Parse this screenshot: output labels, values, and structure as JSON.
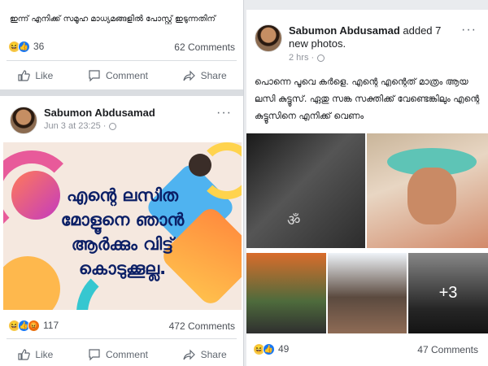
{
  "left_post_top": {
    "text": "ഇന്ന് എനിക്ക് സമൂഹ മാധ്യമങ്ങളിൽ പോസ്റ്റ് ഇടുന്നതിന്",
    "reaction_count": "36",
    "comments": "62 Comments"
  },
  "actions": {
    "like": "Like",
    "comment": "Comment",
    "share": "Share"
  },
  "left_post": {
    "author": "Sabumon Abdusamad",
    "time": "Jun 3 at 23:25 ·",
    "poster_lines": [
      "എന്റെ ലസിത",
      "മോളൂനെ ഞാൻ",
      "ആർക്കും വിട്ട്",
      "കൊടുക്കൂല്ല."
    ],
    "reaction_count": "117",
    "comments": "472 Comments"
  },
  "right_post": {
    "author": "Sabumon Abdusamad",
    "added_text": "added 7 new photos.",
    "time": "2 hrs ·",
    "body": "പൊന്നെ പൂവെ കർളെ. എന്റെ എന്റെത് മാത്രം ആയ ലസി കുട്ടൂസ്. ഏതു സങ്ക സക്തിക്ക് വേണ്ടെങ്കിലും എന്റെ കുട്ടൂസിനെ എനിക്ക് വെണം",
    "more_photos": "+3",
    "reaction_count": "49",
    "comments": "47 Comments"
  },
  "colors": {
    "link_blue": "#1877f2",
    "text_gray": "#606770",
    "poster_navy": "#0b1f66"
  }
}
